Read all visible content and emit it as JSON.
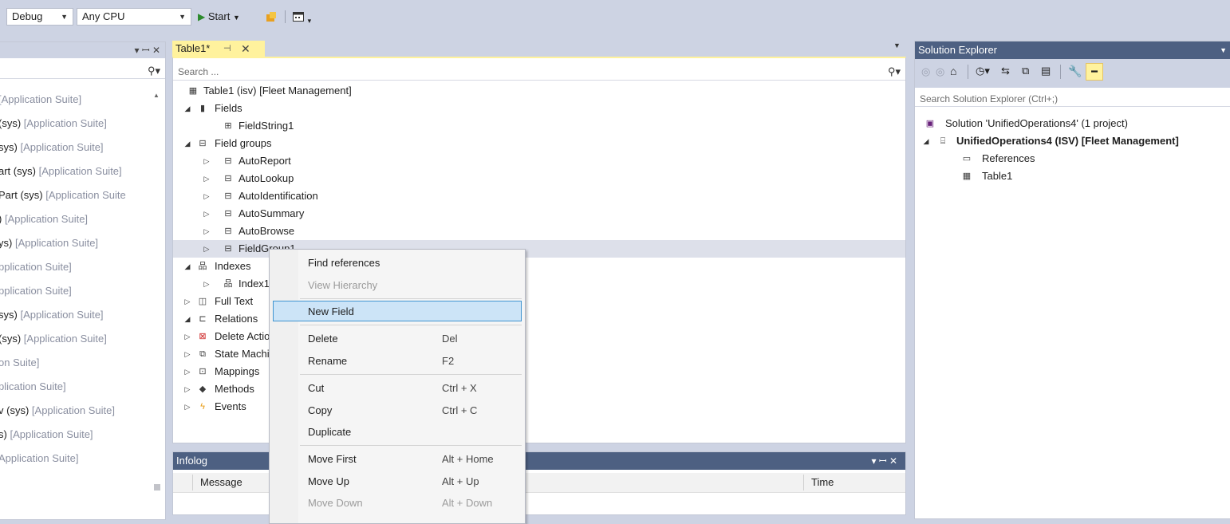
{
  "toolbar": {
    "config": "Debug",
    "platform": "Any CPU",
    "start_label": "Start"
  },
  "left_panel": {
    "items": [
      {
        "bold": "",
        "gray": "[Application Suite]"
      },
      {
        "bold": "(sys)",
        "gray": "[Application Suite]"
      },
      {
        "bold": "sys)",
        "gray": "[Application Suite]"
      },
      {
        "bold": "art (sys)",
        "gray": "[Application Suite]"
      },
      {
        "bold": "Part (sys)",
        "gray": "[Application Suite"
      },
      {
        "bold": ")",
        "gray": "[Application Suite]"
      },
      {
        "bold": "ys)",
        "gray": "[Application Suite]"
      },
      {
        "bold": "",
        "gray": "pplication Suite]"
      },
      {
        "bold": "",
        "gray": "pplication Suite]"
      },
      {
        "bold": "sys)",
        "gray": "[Application Suite]"
      },
      {
        "bold": "(sys)",
        "gray": "[Application Suite]"
      },
      {
        "bold": "",
        "gray": "on Suite]"
      },
      {
        "bold": "",
        "gray": "plication Suite]"
      },
      {
        "bold": "v (sys)",
        "gray": "[Application Suite]"
      },
      {
        "bold": "s)",
        "gray": "[Application Suite]"
      },
      {
        "bold": "",
        "gray": "Application Suite]"
      }
    ]
  },
  "editor": {
    "tab_label": "Table1*",
    "search_placeholder": "Search ...",
    "tree": [
      {
        "label": "Table1 (isv) [Fleet Management]"
      },
      {
        "label": "Fields"
      },
      {
        "label": "FieldString1"
      },
      {
        "label": "Field groups"
      },
      {
        "label": "AutoReport"
      },
      {
        "label": "AutoLookup"
      },
      {
        "label": "AutoIdentification"
      },
      {
        "label": "AutoSummary"
      },
      {
        "label": "AutoBrowse"
      },
      {
        "label": "FieldGroup1"
      },
      {
        "label": "Indexes"
      },
      {
        "label": "Index1"
      },
      {
        "label": "Full Text"
      },
      {
        "label": "Relations"
      },
      {
        "label": "Delete Actions"
      },
      {
        "label": "State Machines"
      },
      {
        "label": "Mappings"
      },
      {
        "label": "Methods"
      },
      {
        "label": "Events"
      }
    ]
  },
  "infolog": {
    "title": "Infolog",
    "col_message": "Message",
    "col_time": "Time"
  },
  "context_menu": {
    "items": [
      {
        "label": "Find references",
        "key": ""
      },
      {
        "label": "View Hierarchy",
        "key": ""
      },
      {
        "label": "New Field",
        "key": ""
      },
      {
        "label": "Delete",
        "key": "Del"
      },
      {
        "label": "Rename",
        "key": "F2"
      },
      {
        "label": "Cut",
        "key": "Ctrl + X"
      },
      {
        "label": "Copy",
        "key": "Ctrl + C"
      },
      {
        "label": "Duplicate",
        "key": ""
      },
      {
        "label": "Move First",
        "key": "Alt + Home"
      },
      {
        "label": "Move Up",
        "key": "Alt + Up"
      },
      {
        "label": "Move Down",
        "key": "Alt + Down"
      }
    ]
  },
  "solution_explorer": {
    "title": "Solution Explorer",
    "search_placeholder": "Search Solution Explorer (Ctrl+;)",
    "solution_label": "Solution 'UnifiedOperations4' (1 project)",
    "project_label": "UnifiedOperations4 (ISV) [Fleet Management]",
    "references_label": "References",
    "table_label": "Table1"
  },
  "colors": {
    "accent": "#3f94d0",
    "highlight": "#cce4f7",
    "tab_active": "#fff29d",
    "background": "#cdd3e3"
  }
}
